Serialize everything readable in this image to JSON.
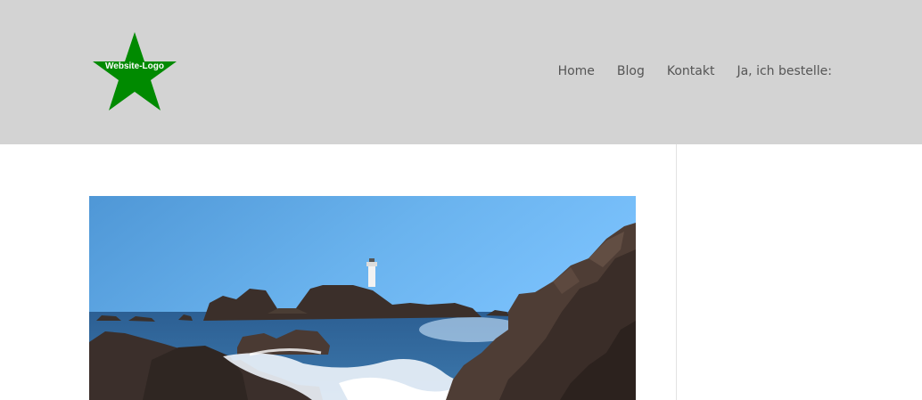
{
  "logo": {
    "text": "Website-Logo",
    "color": "#008a00"
  },
  "nav": {
    "items": [
      {
        "label": "Home"
      },
      {
        "label": "Blog"
      },
      {
        "label": "Kontakt"
      },
      {
        "label": "Ja, ich bestelle:"
      }
    ]
  },
  "colors": {
    "header_bg": "#d3d3d3",
    "nav_text": "#555555",
    "page_bg": "#ffffff"
  },
  "hero_image": {
    "subject": "lighthouse on rocky coast with waves"
  }
}
